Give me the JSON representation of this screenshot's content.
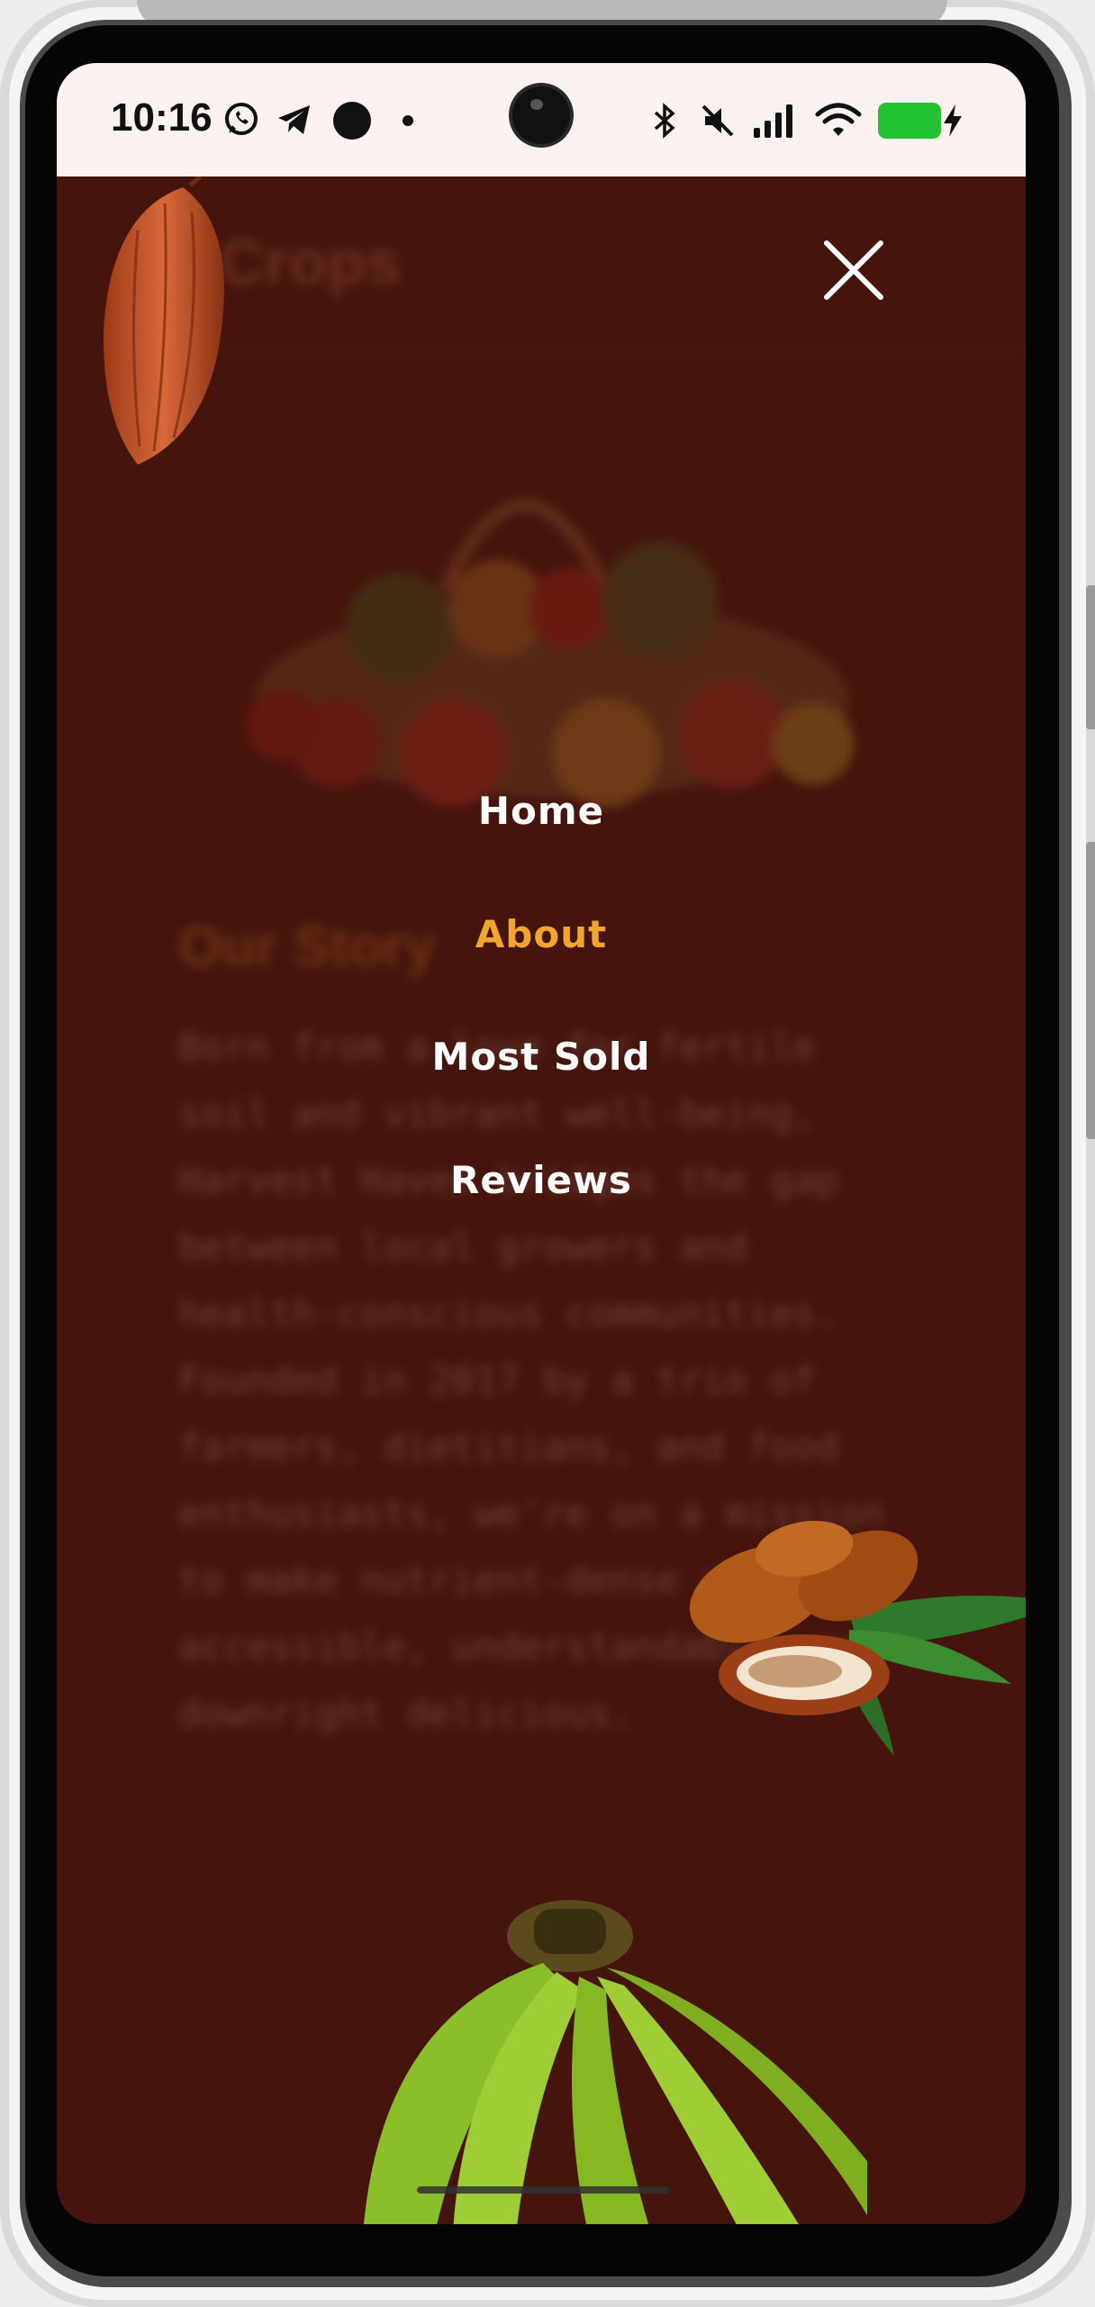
{
  "status_bar": {
    "time": "10:16",
    "left_icons": [
      "whatsapp-icon",
      "telegram-icon",
      "circle-dot-icon",
      "dot-icon"
    ],
    "right_icons": [
      "bluetooth-icon",
      "mute-icon",
      "signal-icon",
      "wifi-icon",
      "battery-charging-icon"
    ],
    "battery_color": "#22c232"
  },
  "background_page": {
    "title": "Crops",
    "section_heading": "Our Story",
    "paragraph": "Born from a love for fertile soil and vibrant well-being, Harvest Haven bridges the gap between local growers and health-conscious communities. Founded in 2017 by a trio of farmers, dietitians, and food enthusiasts, we're on a mission to make nutrient-dense crops accessible, understandable, and downright delicious."
  },
  "menu": {
    "close_icon": "close-icon",
    "items": [
      {
        "label": "Home",
        "active": false
      },
      {
        "label": "About",
        "active": true
      },
      {
        "label": "Most Sold",
        "active": false
      },
      {
        "label": "Reviews",
        "active": false
      }
    ]
  },
  "colors": {
    "overlay_background": "#45140c",
    "active_link": "#f1a52b",
    "link": "#ffffff"
  }
}
